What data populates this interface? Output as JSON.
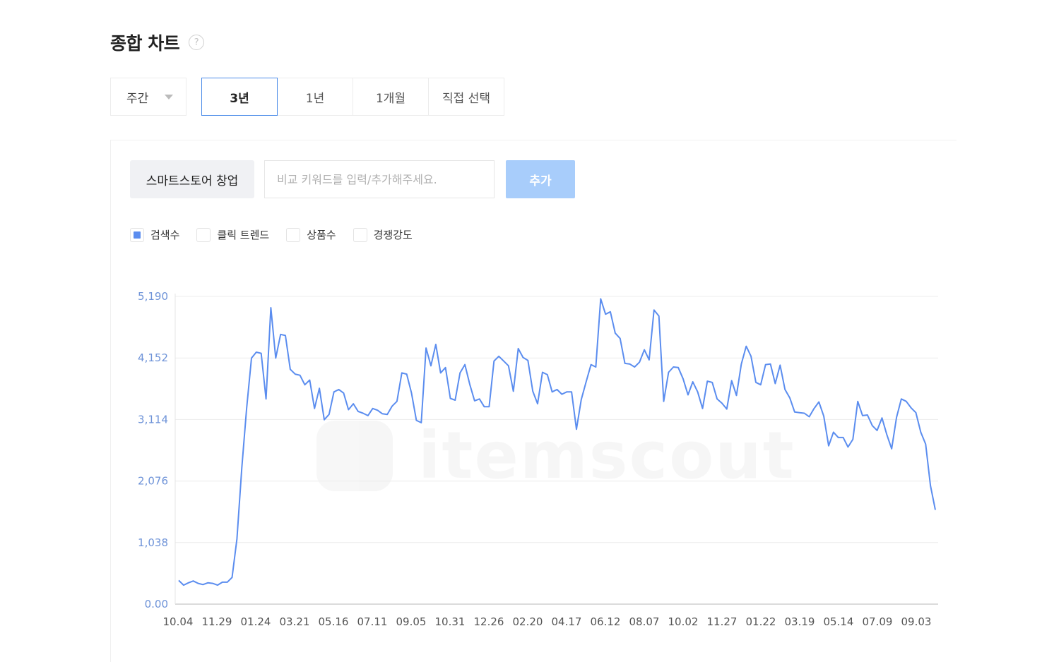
{
  "header": {
    "title": "종합 차트",
    "help_icon": "?"
  },
  "period_select": {
    "value": "주간"
  },
  "range_tabs": [
    {
      "label": "3년",
      "active": true
    },
    {
      "label": "1년",
      "active": false
    },
    {
      "label": "1개월",
      "active": false
    },
    {
      "label": "직접 선택",
      "active": false
    }
  ],
  "keyword": {
    "chip": "스마트스토어 창업",
    "input_placeholder": "비교 키워드를 입력/추가해주세요.",
    "add_label": "추가"
  },
  "legend": [
    {
      "label": "검색수",
      "checked": true
    },
    {
      "label": "클릭 트렌드",
      "checked": false
    },
    {
      "label": "상품수",
      "checked": false
    },
    {
      "label": "경쟁강도",
      "checked": false
    }
  ],
  "watermark": "itemscout",
  "colors": {
    "series": "#5b8def",
    "accent": "#4a8be8",
    "add_button": "#a8cdfb",
    "axis_label": "#6e93d8"
  },
  "chart_data": {
    "type": "line",
    "title": "",
    "xlabel": "",
    "ylabel": "",
    "ylim": [
      0,
      5190
    ],
    "yticks": [
      "0.00",
      "1,038",
      "2,076",
      "3,114",
      "4,152",
      "5,190"
    ],
    "ytick_values": [
      0,
      1038,
      2076,
      3114,
      4152,
      5190
    ],
    "xtick_labels": [
      "10.04",
      "11.29",
      "01.24",
      "03.21",
      "05.16",
      "07.11",
      "09.05",
      "10.31",
      "12.26",
      "02.20",
      "04.17",
      "06.12",
      "08.07",
      "10.02",
      "11.27",
      "01.22",
      "03.19",
      "05.14",
      "07.09",
      "09.03"
    ],
    "grid": true,
    "series": [
      {
        "name": "검색수",
        "values": [
          400,
          320,
          360,
          390,
          350,
          330,
          360,
          350,
          320,
          370,
          370,
          450,
          1100,
          2300,
          3300,
          4150,
          4250,
          4230,
          3460,
          5000,
          4150,
          4550,
          4530,
          3960,
          3880,
          3860,
          3700,
          3780,
          3300,
          3640,
          3110,
          3200,
          3580,
          3620,
          3560,
          3280,
          3380,
          3250,
          3220,
          3180,
          3300,
          3270,
          3210,
          3200,
          3340,
          3420,
          3900,
          3880,
          3560,
          3100,
          3060,
          4320,
          4020,
          4380,
          3900,
          3990,
          3470,
          3440,
          3900,
          4040,
          3710,
          3430,
          3460,
          3330,
          3330,
          4100,
          4180,
          4100,
          4020,
          3590,
          4310,
          4160,
          4110,
          3590,
          3380,
          3910,
          3870,
          3580,
          3620,
          3540,
          3580,
          3580,
          2950,
          3450,
          3750,
          4040,
          4000,
          5150,
          4890,
          4930,
          4570,
          4480,
          4060,
          4050,
          4000,
          4080,
          4290,
          4120,
          4960,
          4860,
          3420,
          3910,
          4000,
          3990,
          3800,
          3530,
          3750,
          3580,
          3300,
          3760,
          3740,
          3460,
          3390,
          3290,
          3770,
          3520,
          4050,
          4350,
          4180,
          3740,
          3700,
          4040,
          4050,
          3720,
          4030,
          3620,
          3480,
          3240,
          3230,
          3220,
          3160,
          3300,
          3410,
          3170,
          2670,
          2900,
          2810,
          2810,
          2650,
          2780,
          3420,
          3180,
          3190,
          3010,
          2930,
          3140,
          2860,
          2620,
          3150,
          3460,
          3420,
          3310,
          3230,
          2900,
          2700,
          2000,
          1590
        ]
      }
    ]
  }
}
